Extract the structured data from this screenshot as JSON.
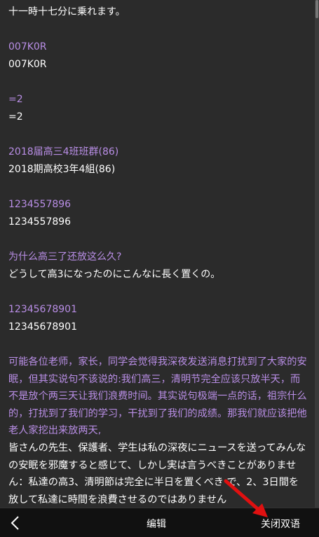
{
  "top_line": "十一時十七分に乗れます。",
  "pairs": [
    {
      "original": "007K0R",
      "translation": "007K0R"
    },
    {
      "original": "=2",
      "translation": "=2"
    },
    {
      "original": "2018届高三4班班群(86)",
      "translation": "2018期高校3年4組(86)"
    },
    {
      "original": "1234557896",
      "translation": "1234557896"
    },
    {
      "original": "为什么高三了还放这么久?",
      "translation": "どうして高3になったのにこんなに長く置くの。"
    },
    {
      "original": "12345678901",
      "translation": "12345678901"
    }
  ],
  "paragraph": {
    "original": "可能各位老师，家长，同学会觉得我深夜发送消息打扰到了大家的安眠，但其实说句不该说的:我们高三，清明节完全应该只放半天，而不是放个两三天让我们浪费时间。其实说句极端一点的话，祖宗什么的，打扰到了我们的学习，干扰到了我们的成绩。那我们就应该把他老人家挖出来放两天,",
    "translation": "皆さんの先生、保護者、学生は私の深夜にニュースを送ってみんなの安眠を邪魔すると感じて、しかし実は言うべきことがありません：私達の高3、清明節は完全に半日を置くべき で、2、3日間を放して私達に時間を浪費させるのではありません"
  },
  "bottom_bar": {
    "edit_label": "编辑",
    "close_bilingual_label": "关闭双语"
  },
  "colors": {
    "background": "#2b2b2b",
    "original_text": "#b98ee6",
    "translated_text": "#ffffff",
    "bottom_bar": "#111111",
    "annotation_arrow": "#e01010"
  }
}
